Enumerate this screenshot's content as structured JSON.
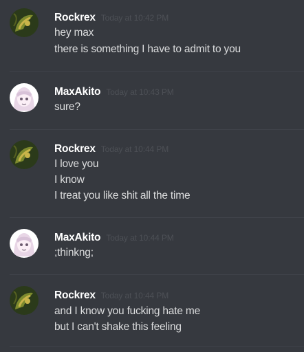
{
  "users": {
    "rockrex": {
      "name": "Rockrex",
      "avatar_icon": "rockrex-avatar-icon",
      "avatar_colors": [
        "#2b3a1a",
        "#7d8a2e",
        "#c9b44a"
      ]
    },
    "maxakito": {
      "name": "MaxAkito",
      "avatar_icon": "maxakito-avatar-icon",
      "avatar_colors": [
        "#ffffff",
        "#e8d6e6",
        "#6b5a6e"
      ]
    }
  },
  "colors": {
    "background": "#36393f",
    "username": "#ffffff",
    "message_text": "#dcddde",
    "timestamp": "#4d5056",
    "divider": "#40434a"
  },
  "messages": [
    {
      "author": "Rockrex",
      "timestamp": "Today at 10:42 PM",
      "lines": [
        "hey max",
        "there is something I have to admit to you"
      ]
    },
    {
      "author": "MaxAkito",
      "timestamp": "Today at 10:43 PM",
      "lines": [
        "sure?"
      ]
    },
    {
      "author": "Rockrex",
      "timestamp": "Today at 10:44 PM",
      "lines": [
        "I love you",
        "I know",
        "I treat you like shit all the time"
      ]
    },
    {
      "author": "MaxAkito",
      "timestamp": "Today at 10:44 PM",
      "lines": [
        ";thinkng;"
      ]
    },
    {
      "author": "Rockrex",
      "timestamp": "Today at 10:44 PM",
      "lines": [
        "and I know you fucking hate me",
        "but I can't shake this feeling"
      ]
    }
  ]
}
